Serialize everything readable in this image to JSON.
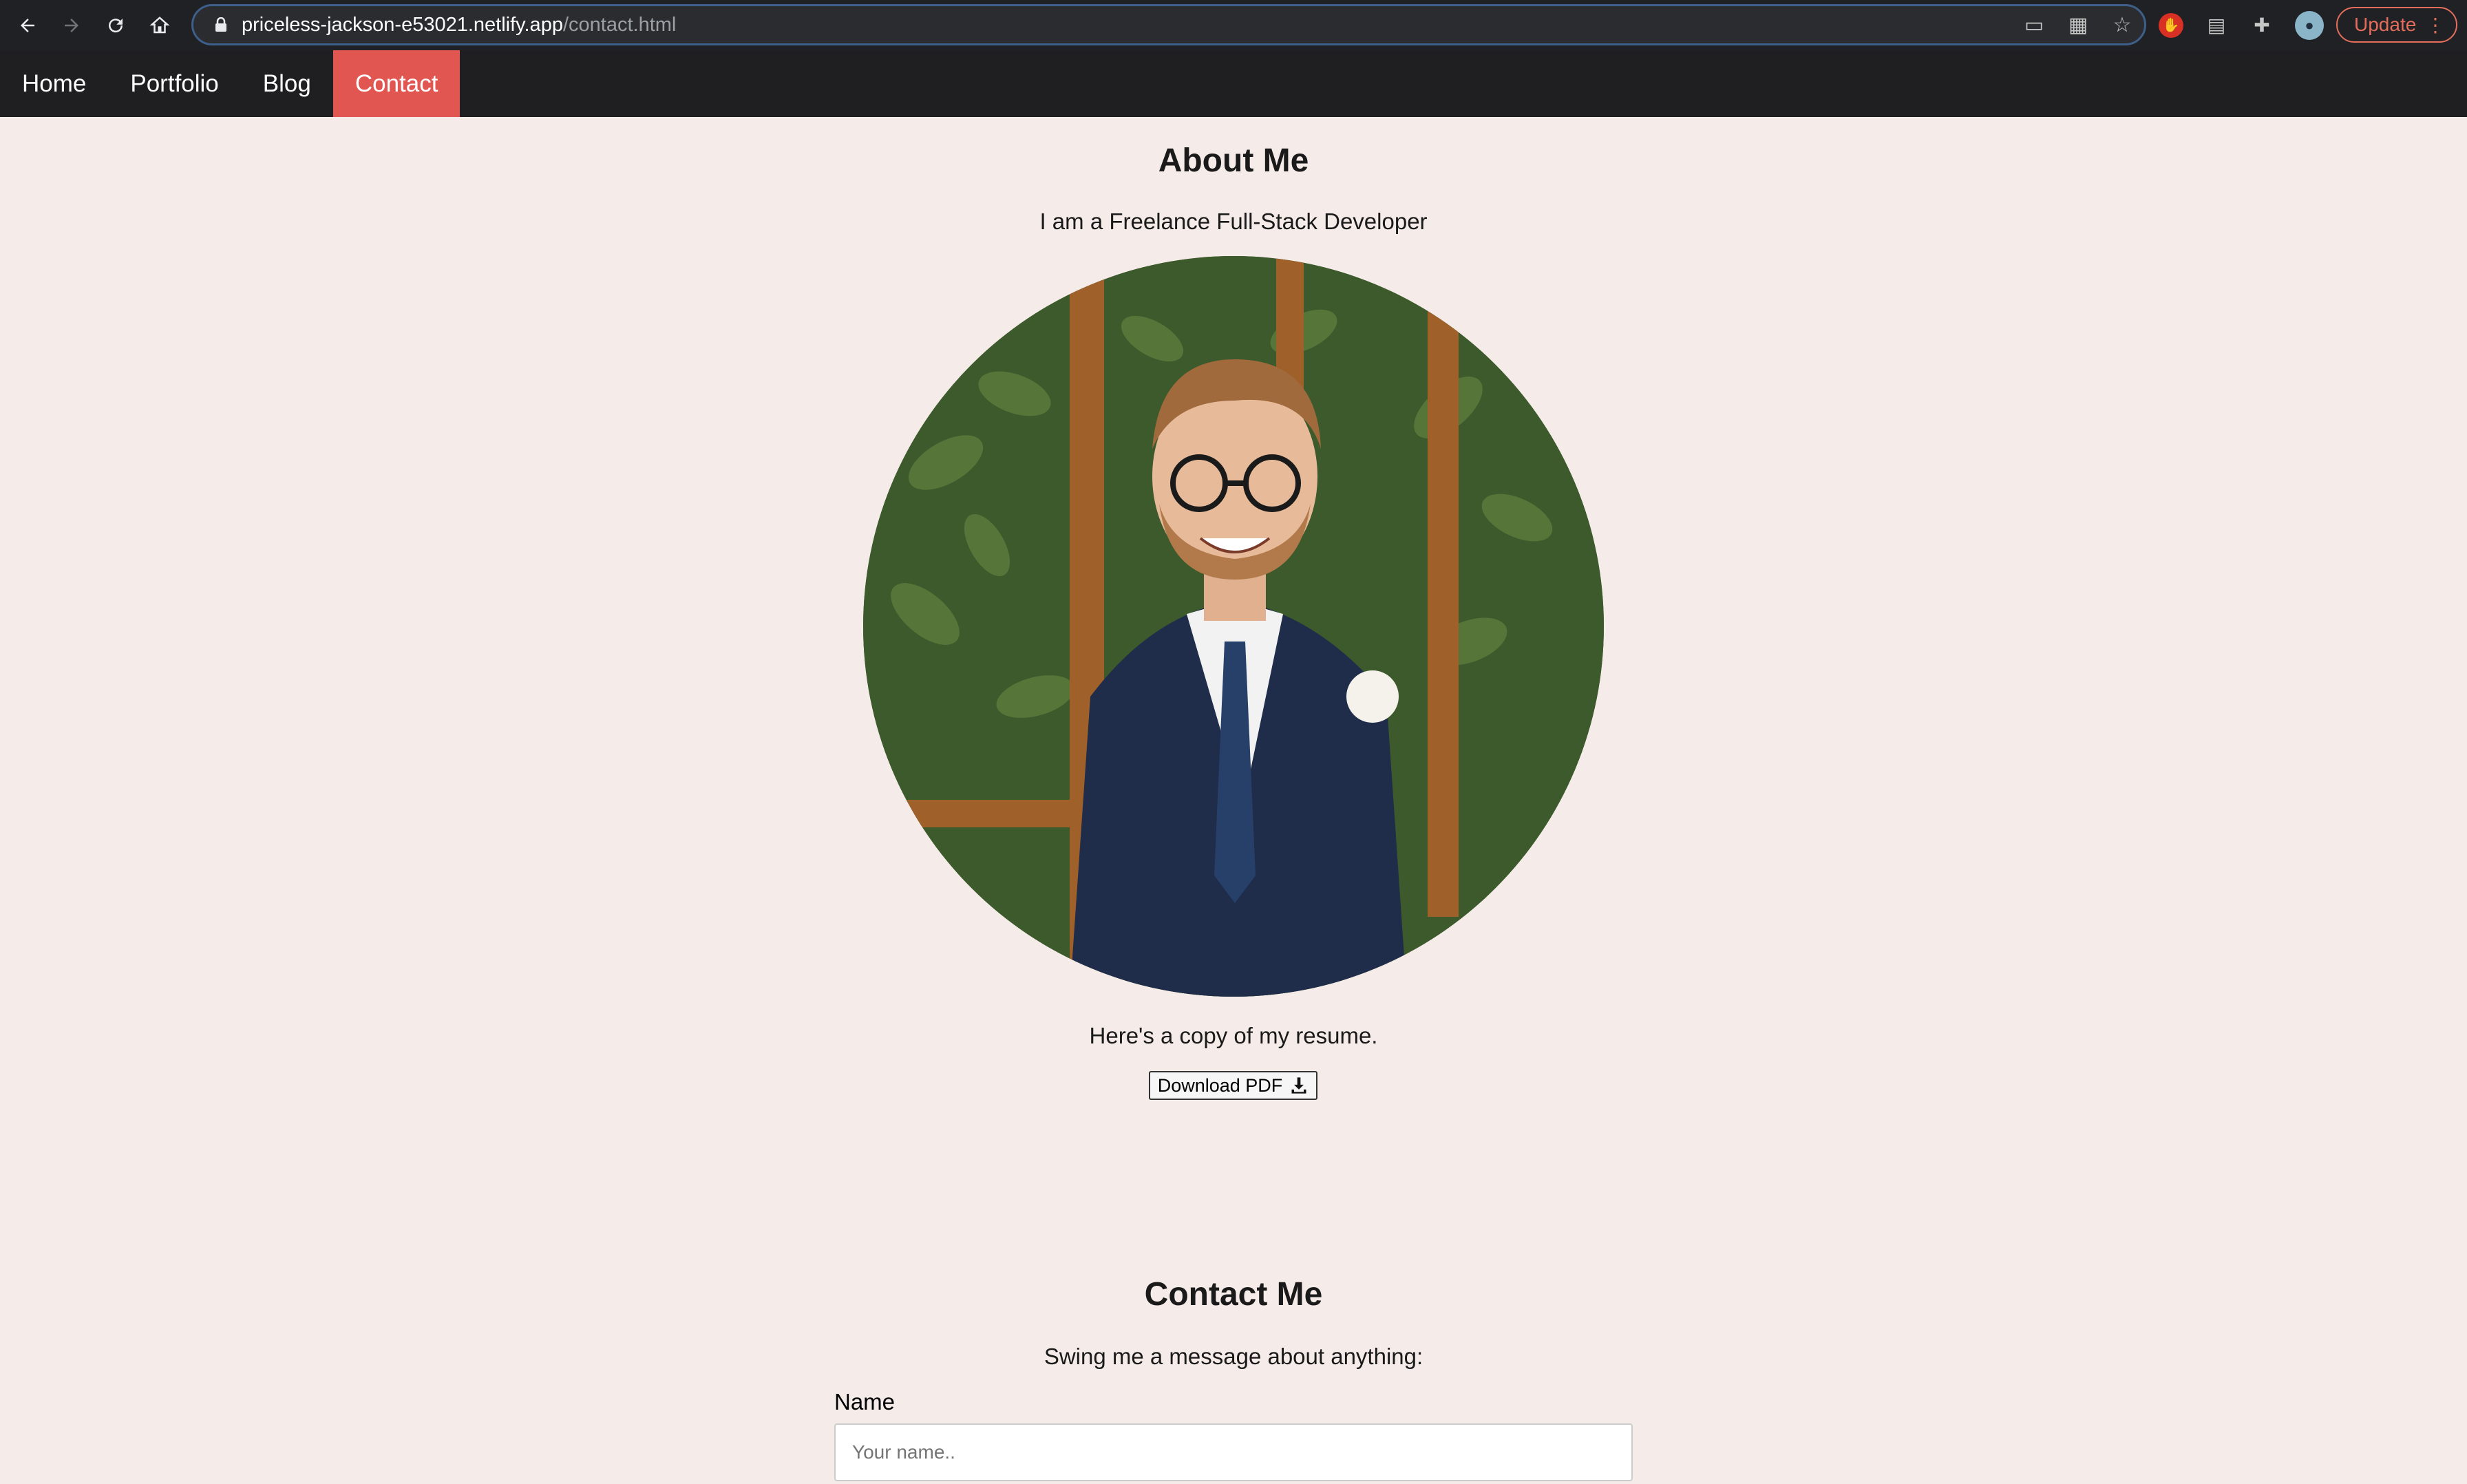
{
  "browser": {
    "url_host": "priceless-jackson-e53021.netlify.app",
    "url_path": "/contact.html",
    "update_label": "Update",
    "icons": [
      "back-icon",
      "forward-icon",
      "reload-icon",
      "home-icon",
      "lock-icon",
      "cast-icon",
      "qr-icon",
      "star-icon",
      "adblock-icon",
      "media-icon",
      "extensions-icon",
      "profile-icon",
      "kebab-menu-icon"
    ]
  },
  "nav": {
    "items": [
      {
        "label": "Home"
      },
      {
        "label": "Portfolio"
      },
      {
        "label": "Blog"
      },
      {
        "label": "Contact"
      }
    ],
    "active": "Contact",
    "active_color": "#e15651"
  },
  "about": {
    "title": "About Me",
    "tagline": "I am a Freelance Full-Stack Developer",
    "resume_text": "Here's a copy of my resume.",
    "download_label": "Download PDF"
  },
  "contact": {
    "title": "Contact Me",
    "subtitle": "Swing me a message about anything:",
    "name_label": "Name",
    "name_placeholder": "Your name.."
  }
}
